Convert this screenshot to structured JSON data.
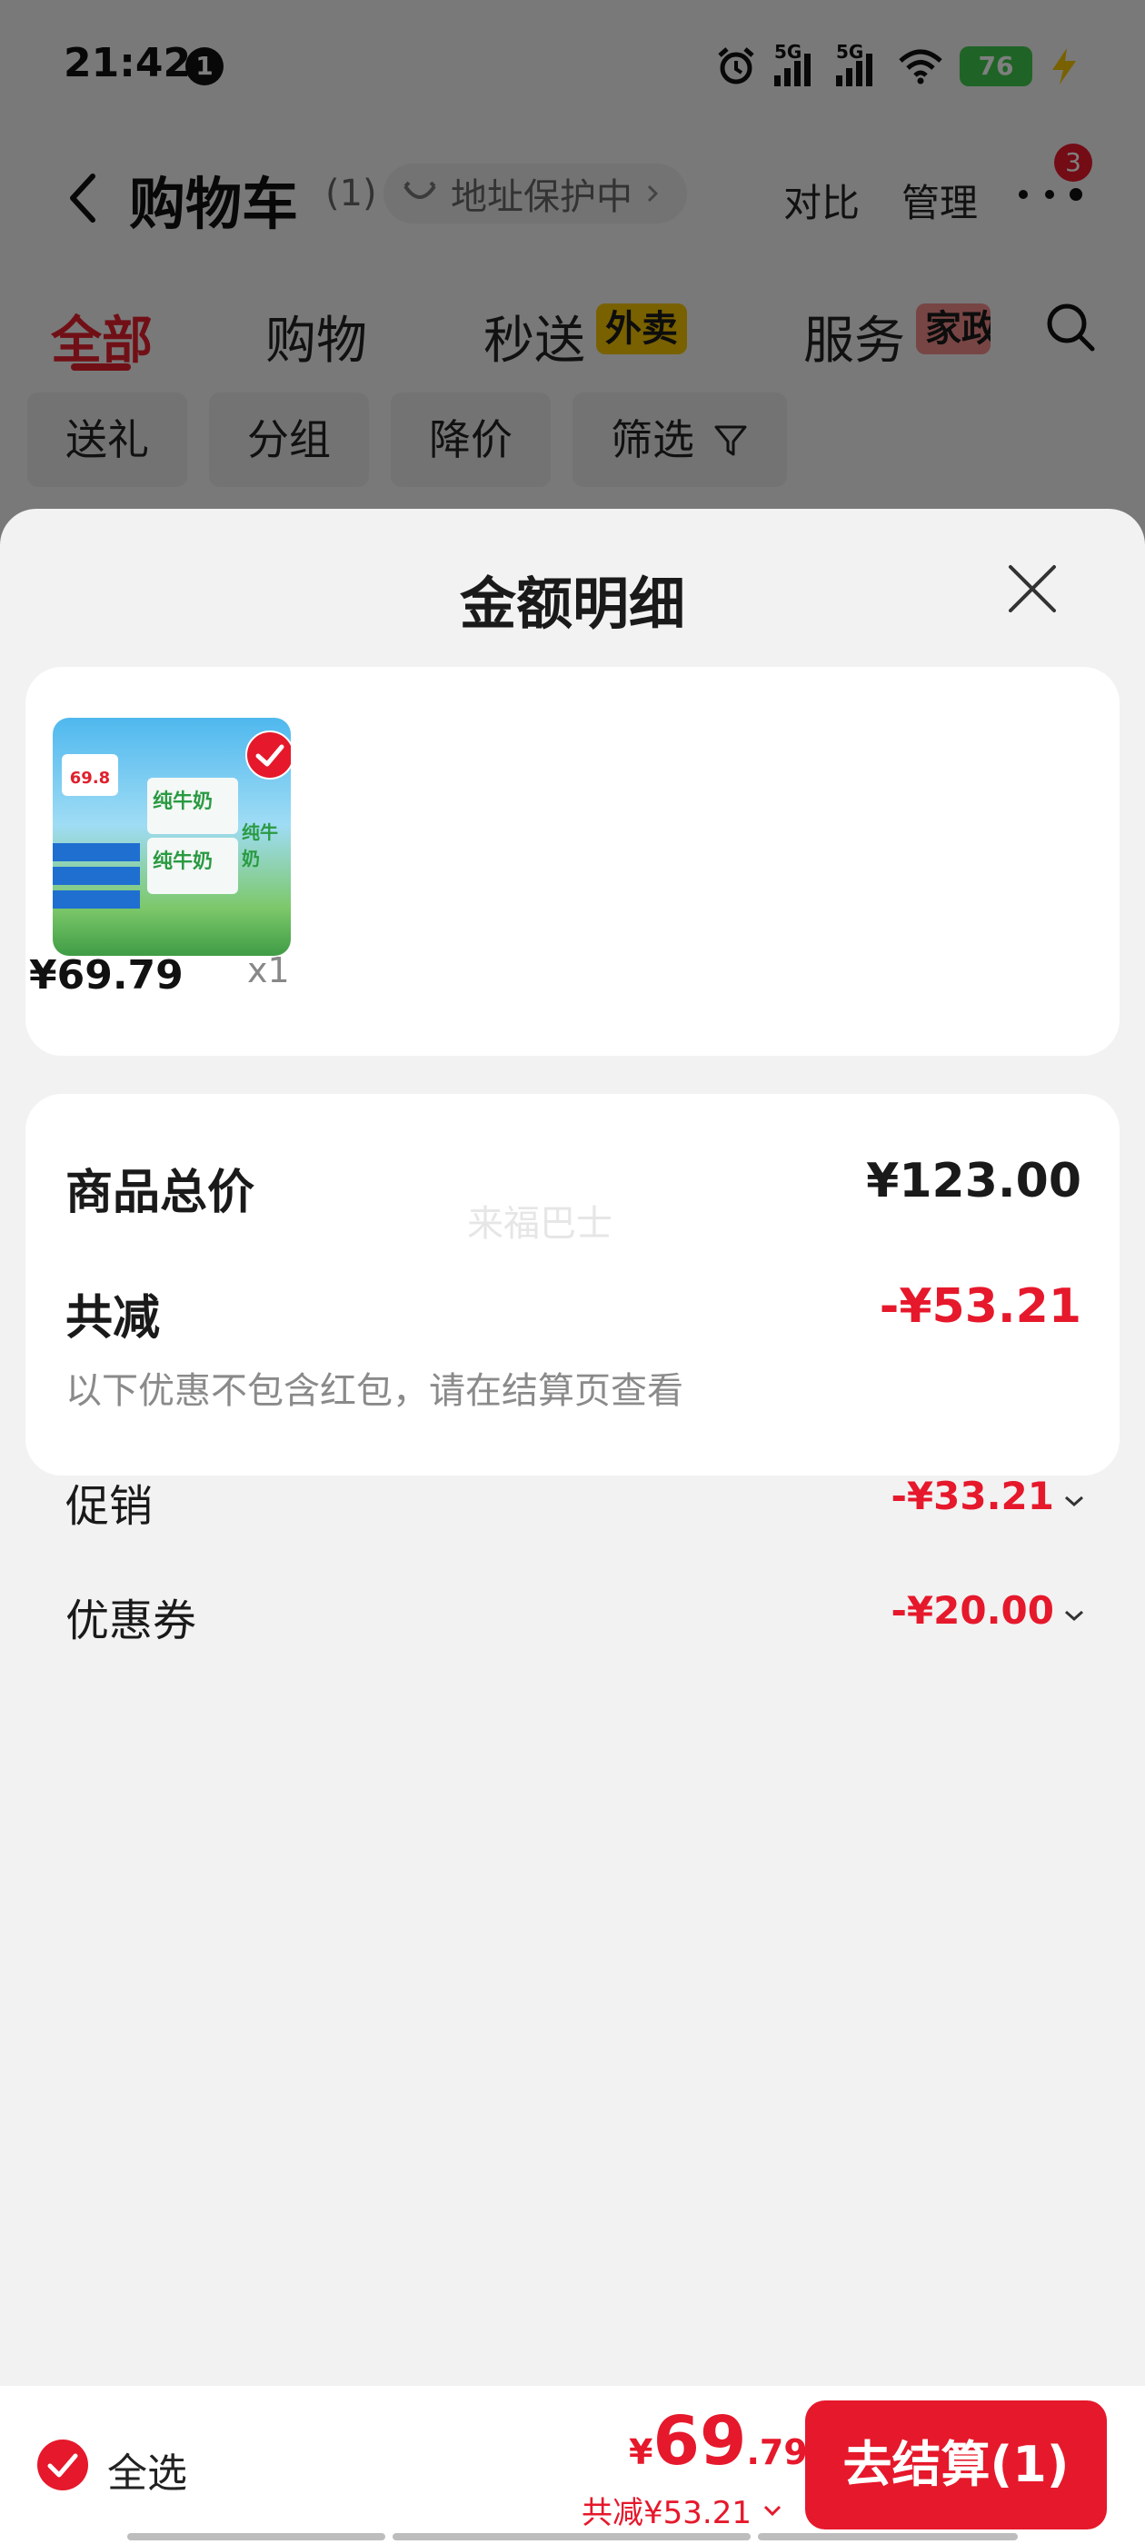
{
  "status_bar": {
    "time": "21:42",
    "notification_count": "1",
    "signal1_label": "5G",
    "signal2_label": "5G",
    "battery": "76"
  },
  "nav": {
    "title": "购物车",
    "count": "(1)",
    "address_label": "地址保护中",
    "compare_label": "对比",
    "manage_label": "管理",
    "more_badge": "3"
  },
  "tabs": {
    "all": "全部",
    "shopping": "购物",
    "flash": "秒送",
    "flash_tag": "外卖",
    "service": "服务",
    "service_tag": "家政"
  },
  "chips": {
    "gift": "送礼",
    "group": "分组",
    "price_drop": "降价",
    "filter": "筛选"
  },
  "sheet": {
    "title": "金额明细",
    "product": {
      "badge_price": "69.8",
      "label": "纯牛奶",
      "price": "¥69.79",
      "qty": "x1"
    },
    "summary": {
      "total_label": "商品总价",
      "total_value": "¥123.00",
      "discount_label": "共减",
      "discount_value": "-¥53.21",
      "hint": "以下优惠不包含红包，请在结算页查看",
      "promo_label": "促销",
      "promo_value": "-¥33.21",
      "coupon_label": "优惠券",
      "coupon_value": "-¥20.00"
    },
    "watermark": "来福巴士"
  },
  "checkout": {
    "select_all": "全选",
    "currency": "¥",
    "total_int": "69",
    "total_dec": ".79",
    "saved": "共减¥53.21",
    "button": "去结算(1)"
  },
  "colors": {
    "accent_red": "#e6182b",
    "battery_green": "#3fc94c",
    "flash_tag_bg": "#f2c200",
    "service_tag_bg": "#f08a8a"
  }
}
